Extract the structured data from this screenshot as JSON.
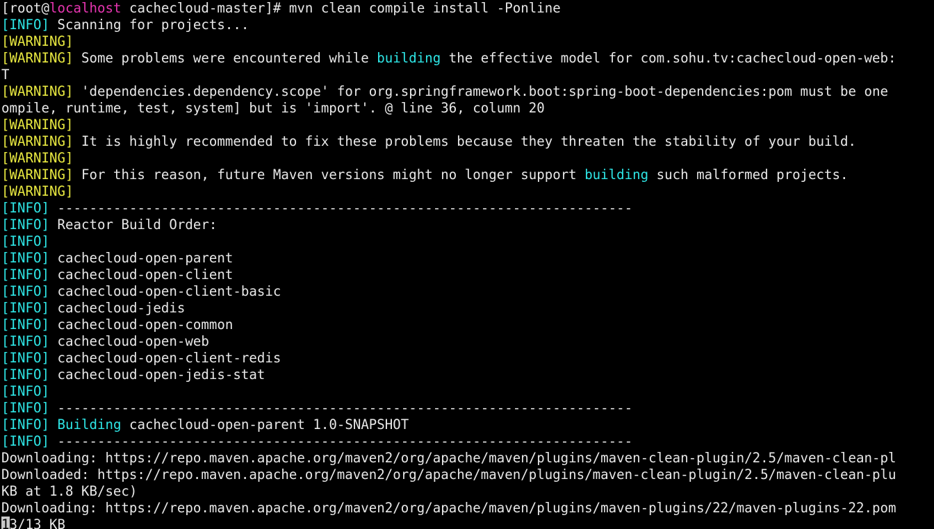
{
  "terminal": {
    "colors": {
      "background": "#000000",
      "foreground": "#e8e8e8",
      "info_tag": "#2ee6e6",
      "warning_tag": "#e8e840",
      "hostname": "#e635b0",
      "cursor": "#c8c8c8"
    },
    "prompt": {
      "bracket_open": "[",
      "user": "root",
      "at": "@",
      "host": "localhost",
      "space": " ",
      "directory": "cachecloud-master",
      "bracket_close": "]#",
      "command": " mvn clean compile install -Ponline"
    },
    "tag_info": "[INFO]",
    "tag_warning": "[WARNING]",
    "separator": "------------------------------------------------------------------------",
    "lines": {
      "scanning": " Scanning for projects...",
      "warn_blank": "",
      "warn_some_problems_a": " Some problems were encountered while ",
      "warn_some_problems_building": "building",
      "warn_some_problems_b": " the effective model for com.sohu.tv:cachecloud-open-web:",
      "warn_some_problems_wrap": "T",
      "warn_scope": " 'dependencies.dependency.scope' for org.springframework.boot:spring-boot-dependencies:pom must be one",
      "warn_scope_wrap": "ompile, runtime, test, system] but is 'import'. @ line 36, column 20",
      "warn_highly_recommended": " It is highly recommended to fix these problems because they threaten the stability of your build.",
      "warn_future_a": " For this reason, future Maven versions might no longer support ",
      "warn_future_building": "building",
      "warn_future_b": " such malformed projects.",
      "reactor_build_order": " Reactor Build Order:",
      "info_blank": "",
      "building_label": "Building",
      "building_project": " cachecloud-open-parent 1.0-SNAPSHOT",
      "download_1": "Downloading: https://repo.maven.apache.org/maven2/org/apache/maven/plugins/maven-clean-plugin/2.5/maven-clean-pl",
      "download_2": "Downloaded: https://repo.maven.apache.org/maven2/org/apache/maven/plugins/maven-clean-plugin/2.5/maven-clean-plu",
      "download_2_wrap": "KB at 1.8 KB/sec)",
      "download_3": "Downloading: https://repo.maven.apache.org/maven2/org/apache/maven/plugins/maven-plugins/22/maven-plugins-22.pom",
      "progress_cursor_char": "1",
      "progress_rest": "3/13 KB"
    },
    "reactor_modules": [
      " cachecloud-open-parent",
      " cachecloud-open-client",
      " cachecloud-open-client-basic",
      " cachecloud-jedis",
      " cachecloud-open-common",
      " cachecloud-open-web",
      " cachecloud-open-client-redis",
      " cachecloud-open-jedis-stat"
    ]
  }
}
